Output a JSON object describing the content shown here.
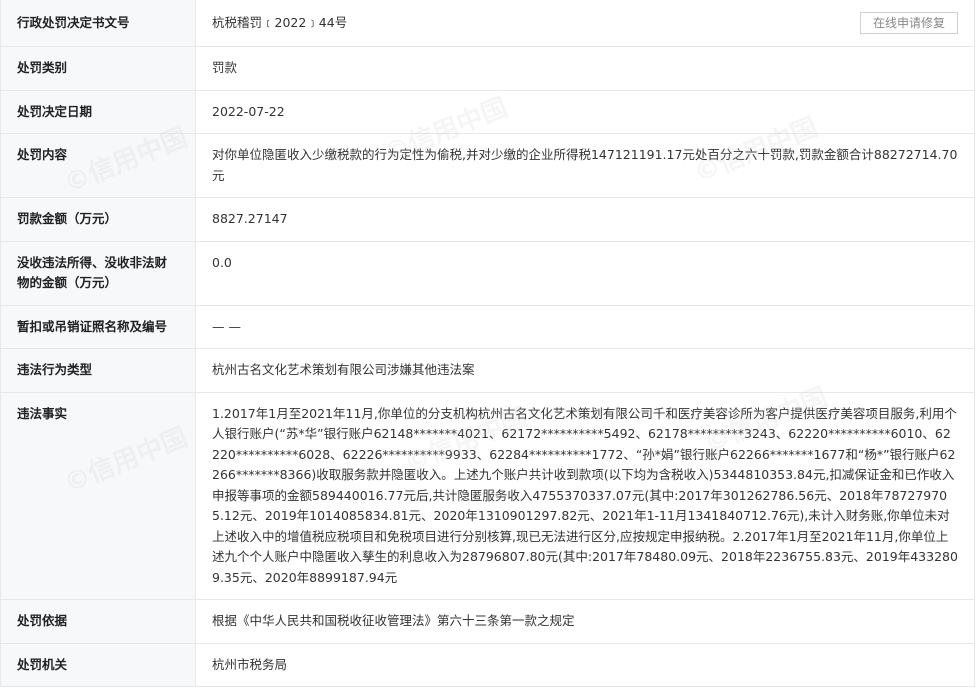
{
  "rows": [
    {
      "label": "行政处罚决定书文号",
      "value": "杭税稽罚﹝2022﹞44号"
    },
    {
      "label": "处罚类别",
      "value": "罚款"
    },
    {
      "label": "处罚决定日期",
      "value": "2022-07-22"
    },
    {
      "label": "处罚内容",
      "value": "对你单位隐匿收入少缴税款的行为定性为偷税,并对少缴的企业所得税147121191.17元处百分之六十罚款,罚款金额合计88272714.70元"
    },
    {
      "label": "罚款金额（万元）",
      "value": "8827.27147"
    },
    {
      "label": "没收违法所得、没收非法财物的金额（万元）",
      "value": "0.0"
    },
    {
      "label": "暂扣或吊销证照名称及编号",
      "value": "— —"
    },
    {
      "label": "违法行为类型",
      "value": "杭州古名文化艺术策划有限公司涉嫌其他违法案"
    },
    {
      "label": "违法事实",
      "value": "1.2017年1月至2021年11月,你单位的分支机构杭州古名文化艺术策划有限公司千和医疗美容诊所为客户提供医疗美容项目服务,利用个人银行账户(“苏*华”银行账户62148*******4021、62172**********5492、62178*********3243、62220**********6010、62220**********6028、62226**********9933、62284**********1772、“孙*娟”银行账户62266*******1677和“杨*”银行账户62266*******8366)收取服务款并隐匿收入。上述九个账户共计收到款项(以下均为含税收入)5344810353.84元,扣减保证金和已作收入申报等事项的金额589440016.77元后,共计隐匿服务收入4755370337.07元(其中:2017年301262786.56元、2018年787279705.12元、2019年1014085834.81元、2020年1310901297.82元、2021年1-11月1341840712.76元),未计入财务账,你单位未对上述收入中的增值税应税项目和免税项目进行分别核算,现已无法进行区分,应按规定申报纳税。2.2017年1月至2021年11月,你单位上述九个个人账户中隐匿收入孳生的利息收入为28796807.80元(其中:2017年78480.09元、2018年2236755.83元、2019年4332809.35元、2020年8899187.94元"
    },
    {
      "label": "处罚依据",
      "value": "根据《中华人民共和国税收征收管理法》第六十三条第一款之规定"
    },
    {
      "label": "处罚机关",
      "value": "杭州市税务局"
    }
  ],
  "repair_button": "在线申请修复",
  "watermark_text": "信用中国"
}
